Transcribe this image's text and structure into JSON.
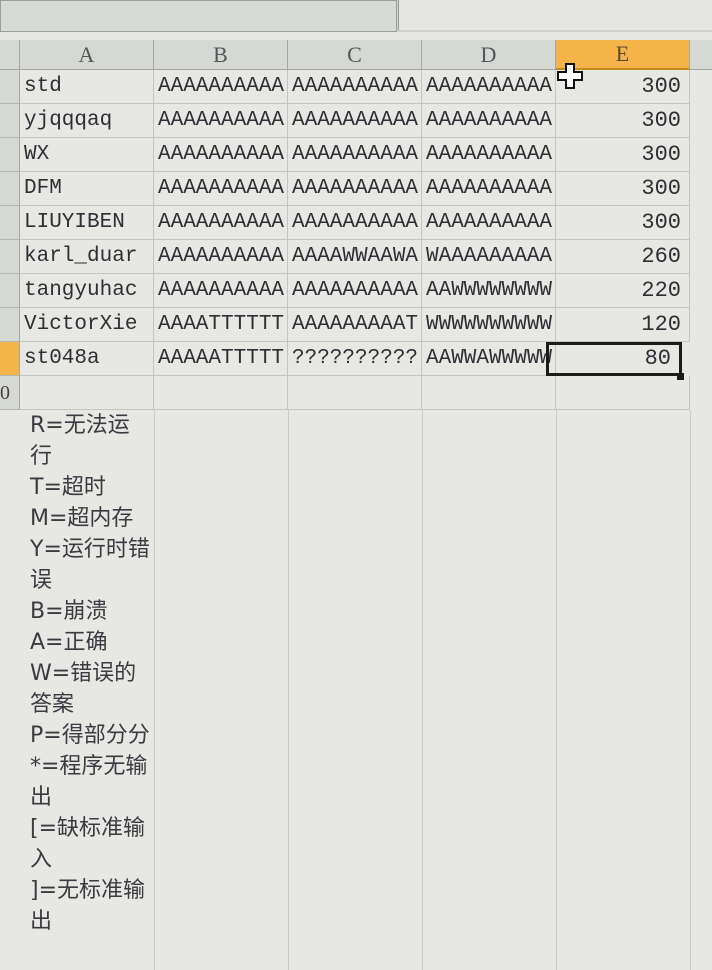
{
  "columns": [
    "A",
    "B",
    "C",
    "D",
    "E"
  ],
  "selected_column": "E",
  "rows": [
    {
      "a": "std",
      "b": "AAAAAAAAAA",
      "c": "AAAAAAAAAA",
      "d": "AAAAAAAAAA",
      "e": "300"
    },
    {
      "a": "yjqqqaq",
      "b": "AAAAAAAAAA",
      "c": "AAAAAAAAAA",
      "d": "AAAAAAAAAA",
      "e": "300"
    },
    {
      "a": "WX",
      "b": "AAAAAAAAAA",
      "c": "AAAAAAAAAA",
      "d": "AAAAAAAAAA",
      "e": "300"
    },
    {
      "a": "DFM",
      "b": "AAAAAAAAAA",
      "c": "AAAAAAAAAA",
      "d": "AAAAAAAAAA",
      "e": "300"
    },
    {
      "a": "LIUYIBEN",
      "b": "AAAAAAAAAA",
      "c": "AAAAAAAAAA",
      "d": "AAAAAAAAAA",
      "e": "300"
    },
    {
      "a": "karl_duar",
      "b": "AAAAAAAAAA",
      "c": "AAAAWWAAWA",
      "d": "WAAAAAAAAA",
      "e": "260"
    },
    {
      "a": "tangyuhac",
      "b": "AAAAAAAAAA",
      "c": "AAAAAAAAAA",
      "d": "AAWWWWWWWW",
      "e": "220"
    },
    {
      "a": "VictorXie",
      "b": "AAAATTTTTT",
      "c": "AAAAAAAAAT",
      "d": "WWWWWWWWWW",
      "e": "120"
    },
    {
      "a": "st048a",
      "b": "AAAAATTTTT",
      "c": "??????????",
      "d": "AAWWAWWWWW",
      "e": "80"
    }
  ],
  "row10_label": "0",
  "legend": [
    "R=无法运行",
    "T=超时",
    "M=超内存",
    "Y=运行时错误",
    "B=崩溃",
    "A=正确",
    "W=错误的答案",
    "P=得部分分",
    "*=程序无输出",
    "[=缺标准输入",
    "]=无标准输出"
  ]
}
